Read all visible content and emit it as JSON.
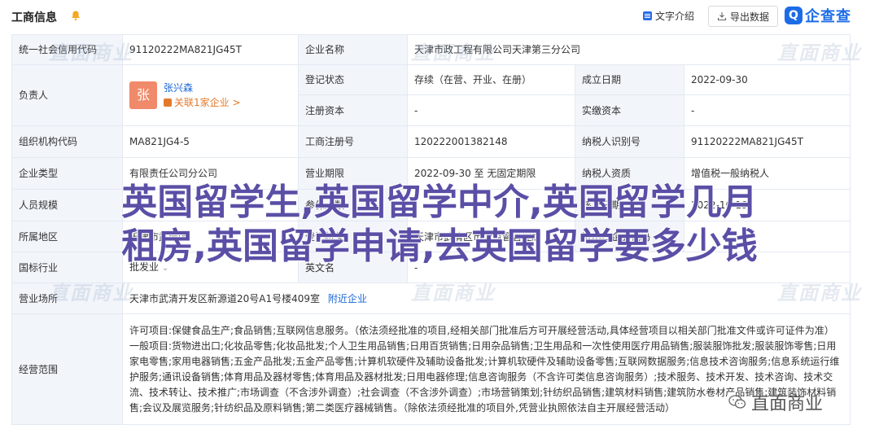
{
  "header": {
    "title": "工商信息",
    "intro_label": "文字介绍",
    "export_label": "导出数据",
    "logo_text": "企查查",
    "logo_mark": "Q"
  },
  "rows": {
    "credit_code_label": "统一社会信用代码",
    "credit_code": "91120222MA821JG45T",
    "company_name_label": "企业名称",
    "company_name": "天津市政工程有限公司天津第三分公司",
    "legal_rep_label": "负责人",
    "legal_rep_avatar": "张",
    "legal_rep_name": "张兴森",
    "legal_rep_related": "关联1家企业 >",
    "reg_status_label": "登记状态",
    "reg_status": "存续（在营、开业、在册）",
    "est_date_label": "成立日期",
    "est_date": "2022-09-30",
    "reg_capital_label": "注册资本",
    "reg_capital": "-",
    "paid_capital_label": "实缴资本",
    "paid_capital": "-",
    "org_code_label": "组织机构代码",
    "org_code": "MA821JG4-5",
    "biz_reg_no_label": "工商注册号",
    "biz_reg_no": "120222001382148",
    "taxpayer_id_label": "纳税人识别号",
    "taxpayer_id": "91120222MA821JG45T",
    "company_type_label": "企业类型",
    "company_type": "有限责任公司分公司",
    "biz_term_label": "营业期限",
    "biz_term": "2022-09-30 至 无固定期限",
    "taxpayer_qual_label": "纳税人资质",
    "taxpayer_qual": "增值税一般纳税人",
    "staff_size_label": "人员规模",
    "insured_label": "参保人数",
    "approval_date_label": "核准日期",
    "approval_date": "2022-10-19",
    "region_label": "所属地区",
    "region": "天津市武清区",
    "reg_authority_label": "登记机关",
    "reg_authority": "天津市武清区市场监督管理局",
    "import_export_label": "进出口企业代码",
    "industry_label": "国标行业",
    "industry": "批发业",
    "english_name_label": "英文名",
    "english_name": "-",
    "address_label": "营业场所",
    "address": "天津市武清开发区新源道20号A1号楼409室",
    "address_link": "附近企业",
    "scope_label": "经营范围",
    "scope": "许可项目:保健食品生产;食品销售;互联网信息服务。（依法须经批准的项目,经相关部门批准后方可开展经营活动,具体经营项目以相关部门批准文件或许可证件为准）一般项目:货物进出口;化妆品零售;化妆品批发;个人卫生用品销售;日用百货销售;日用杂品销售;卫生用品和一次性使用医疗用品销售;服装服饰批发;服装服饰零售;日用家电零售;家用电器销售;五金产品批发;五金产品零售;计算机软硬件及辅助设备批发;计算机软硬件及辅助设备零售;互联网数据服务;信息技术咨询服务;信息系统运行维护服务;通讯设备销售;体育用品及器材零售;体育用品及器材批发;日用电器修理;信息咨询服务（不含许可类信息咨询服务）;技术服务、技术开发、技术咨询、技术交流、技术转让、技术推广;市场调查（不含涉外调查）;社会调查（不含涉外调查）;市场营销策划;针纺织品销售;建筑材料销售;建筑防水卷材产品销售;建筑装饰材料销售;会议及展览服务;针纺织品及原料销售;第二类医疗器械销售。（除依法须经批准的项目外,凭营业执照依法自主开展经营活动）"
  },
  "watermark_text": "直面商业",
  "overlay": {
    "line1": "英国留学生,英国留学中介,英国留学几月",
    "line2": "租房,英国留学申请,去英国留学要多少钱"
  },
  "wechat_mark": "直面商业",
  "colors": {
    "accent": "#1a66d9",
    "label_bg": "#f2f5fa",
    "border": "#e4e9f2",
    "overlay": "#5a4fa6",
    "avatar": "#f08a6a",
    "related": "#e37a2b"
  }
}
